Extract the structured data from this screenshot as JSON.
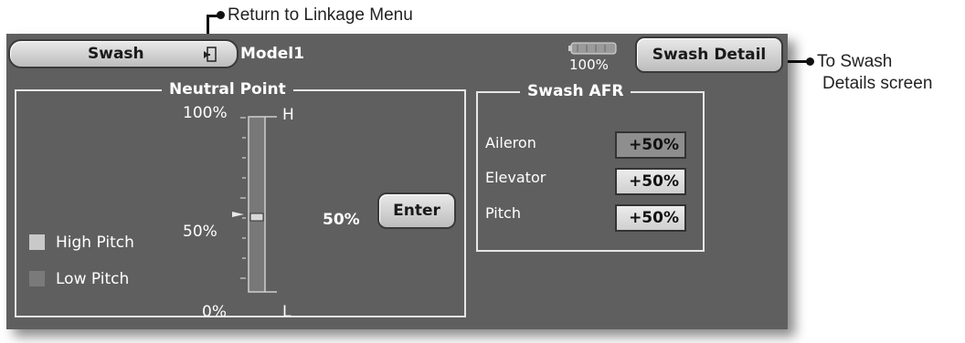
{
  "callouts": {
    "return_menu": "Return to Linkage Menu",
    "swash_details_1": "To Swash",
    "swash_details_2": "Details screen"
  },
  "header": {
    "screen_button": "Swash",
    "model_name": "Model1",
    "battery_percent": "100%",
    "detail_button": "Swash Detail"
  },
  "neutral_point": {
    "title": "Neutral Point",
    "scale_top": "100%",
    "scale_mid": "50%",
    "scale_bottom": "0%",
    "label_high": "H",
    "label_low": "L",
    "current_value": "50%",
    "enter_button": "Enter",
    "slider_level": 0.5,
    "legend_high": "High Pitch",
    "legend_low": "Low Pitch"
  },
  "swash_afr": {
    "title": "Swash AFR",
    "rows": [
      {
        "label": "Aileron",
        "value": "+50%"
      },
      {
        "label": "Elevator",
        "value": "+50%"
      },
      {
        "label": "Pitch",
        "value": "+50%"
      }
    ]
  },
  "colors": {
    "screen_bg": "#5f5f5f",
    "high_pitch_swatch": "#c9c9c9",
    "low_pitch_swatch": "#7a7a7a"
  }
}
